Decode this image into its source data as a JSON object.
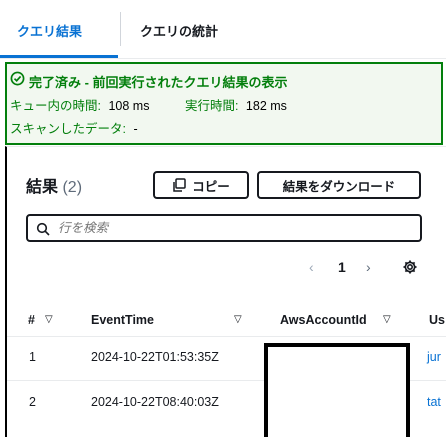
{
  "tabs": [
    {
      "label": "クエリ結果"
    },
    {
      "label": "クエリの統計"
    }
  ],
  "status": {
    "title": "完了済み - 前回実行されたクエリ結果の表示",
    "queue_label": "キュー内の時間:",
    "queue_value": "108 ms",
    "run_label": "実行時間:",
    "run_value": "182 ms",
    "scanned_label": "スキャンしたデータ:",
    "scanned_value": "-"
  },
  "results": {
    "title": "結果",
    "count": "(2)",
    "copy_label": "コピー",
    "download_label": "結果をダウンロード",
    "filter_placeholder": "行を検索"
  },
  "pagination": {
    "prev": "‹",
    "page": "1",
    "next": "›"
  },
  "table": {
    "columns": [
      "#",
      "EventTime",
      "AwsAccountId",
      "Us"
    ],
    "rows": [
      {
        "num": "1",
        "event_time": "2024-10-22T01:53:35Z",
        "account": "",
        "user": "jur"
      },
      {
        "num": "2",
        "event_time": "2024-10-22T08:40:03Z",
        "account": "",
        "user": "tat"
      }
    ]
  },
  "colors": {
    "accent": "#0972d3",
    "success": "#037f0c"
  }
}
